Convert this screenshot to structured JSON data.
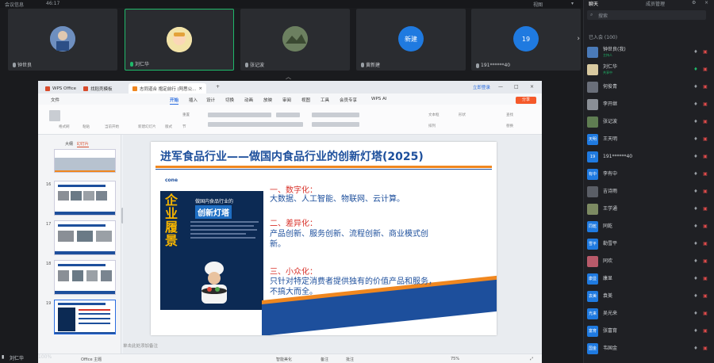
{
  "topbar": {
    "left": "会议信息",
    "timer": "46:17",
    "view": "视图",
    "panel_tab1": "聊天",
    "panel_tab2": "成员管理"
  },
  "tiles": [
    {
      "name": "钟世良",
      "avatar_text": ""
    },
    {
      "name": "刘仁华",
      "avatar_text": ""
    },
    {
      "name": "张记波",
      "avatar_text": ""
    },
    {
      "name": "黄新建",
      "avatar_text": "新建"
    },
    {
      "name": "191******40",
      "avatar_text": "19"
    }
  ],
  "screen": {
    "tabs": [
      "WPS Office",
      "找稻壳模板",
      "志同道合 抱定前行 (阿思公..."
    ],
    "login": "立即登录",
    "menu": [
      "文件",
      "开始",
      "插入",
      "设计",
      "切换",
      "动画",
      "放映",
      "审阅",
      "视图",
      "工具",
      "会员专享",
      "WPS AI"
    ],
    "share": "分享",
    "ribbon_texts": [
      "格式刷",
      "粘贴",
      "当前开始",
      "新建幻灯片",
      "版式",
      "节",
      "重置",
      "文本框",
      "排列",
      "形状",
      "查找",
      "替换"
    ],
    "panel_tabs": [
      "大纲",
      "幻灯片"
    ],
    "slide_numbers": [
      "16",
      "17",
      "18",
      "19"
    ],
    "notes": "单击此处添加备注",
    "status": {
      "theme": "Office 主题",
      "zoom": "75%",
      "layout": "智能美化",
      "comments": "备注",
      "annotation": "批注"
    }
  },
  "slide": {
    "title": "进军食品行业——做国内食品行业的创新灯塔(2025)",
    "poster": {
      "logo": "cone",
      "big": "企业履景",
      "h1": "做国内食品行业的",
      "h2": "创新灯塔"
    },
    "points": [
      {
        "head": "一、数字化：",
        "body": "大数据、人工智能、物联网、云计算。"
      },
      {
        "head": "二、差异化：",
        "body": "产品创新、服务创新、流程创新、商业模式创新。"
      },
      {
        "head": "三、小众化：",
        "body": "只针对特定消费者提供独有的价值产品和服务，不搞大而全。"
      }
    ]
  },
  "minibar": {
    "self": "刘仁华",
    "zoom": "100%"
  },
  "sidebar": {
    "search_placeholder": "搜索",
    "section": "已入会 (100)",
    "members": [
      {
        "name": "钟世良(我)",
        "tag": "主持人",
        "icon": "photo",
        "color": "#4a7ab8"
      },
      {
        "name": "刘仁华",
        "tag": "共享中",
        "icon": "photo",
        "color": "#d8c9a0"
      },
      {
        "name": "何俊青",
        "tag": "",
        "icon": "photo",
        "color": "#6a6f7a"
      },
      {
        "name": "李开继",
        "tag": "",
        "icon": "photo",
        "color": "#8a8f96"
      },
      {
        "name": "张记波",
        "tag": "",
        "icon": "photo",
        "color": "#5f7d52"
      },
      {
        "name": "王天明",
        "tag": "",
        "icon": "天明",
        "color": "#1f7ae0"
      },
      {
        "name": "191******40",
        "tag": "",
        "icon": "19",
        "color": "#1f7ae0"
      },
      {
        "name": "李有中",
        "tag": "",
        "icon": "有中",
        "color": "#1f7ae0"
      },
      {
        "name": "吉诗雨",
        "tag": "",
        "icon": "photo",
        "color": "#5a5e66"
      },
      {
        "name": "王学通",
        "tag": "",
        "icon": "photo",
        "color": "#7c8a62"
      },
      {
        "name": "同乾",
        "tag": "",
        "icon": "同乾",
        "color": "#1f7ae0"
      },
      {
        "name": "勒雪平",
        "tag": "",
        "icon": "雪平",
        "color": "#1f7ae0"
      },
      {
        "name": "同欢",
        "tag": "",
        "icon": "photo",
        "color": "#b85a6a"
      },
      {
        "name": "康显",
        "tag": "",
        "icon": "康显",
        "color": "#1f7ae0"
      },
      {
        "name": "袁美",
        "tag": "",
        "icon": "袁美",
        "color": "#1f7ae0"
      },
      {
        "name": "吴光来",
        "tag": "",
        "icon": "光来",
        "color": "#1f7ae0"
      },
      {
        "name": "张富育",
        "tag": "",
        "icon": "富育",
        "color": "#1f7ae0"
      },
      {
        "name": "韦国金",
        "tag": "",
        "icon": "国金",
        "color": "#1f7ae0"
      }
    ]
  }
}
